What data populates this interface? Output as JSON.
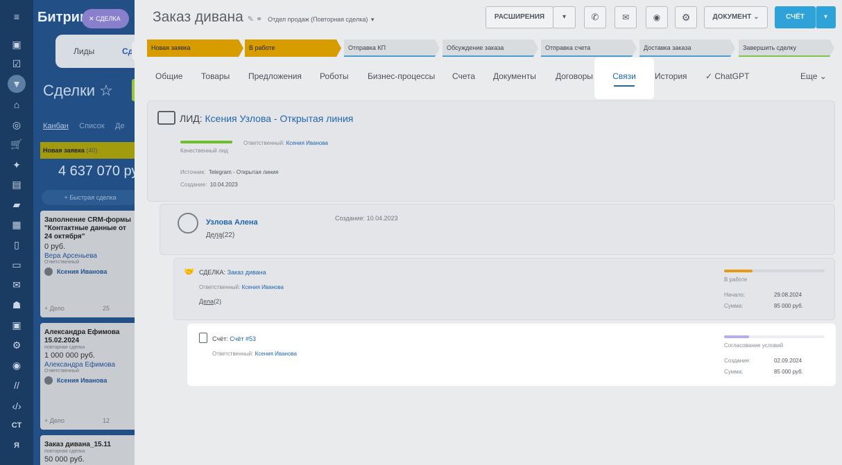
{
  "rail": {
    "items": [
      "menu-icon",
      "home-icon",
      "tasks-icon",
      "filter-icon",
      "bank-icon",
      "target-icon",
      "cart-icon",
      "puzzle-icon",
      "window-icon",
      "chat-icon",
      "calendar-icon",
      "document-icon",
      "drive-icon",
      "mail-icon",
      "team-icon",
      "id-icon",
      "robot-icon",
      "database-icon",
      "marketing-icon",
      "code-icon"
    ],
    "ct": "СТ",
    "ya": "Я"
  },
  "background": {
    "brand": "Битрик",
    "deal_chip": "СДЕЛКА",
    "tab_leads": "Лиды",
    "tab_deals": "Сд",
    "title": "Сделки",
    "views": {
      "kanban": "Канбан",
      "list": "Список",
      "other": "Де"
    },
    "column": {
      "name": "Новая заявка",
      "count": "(40)",
      "sum": "4 637 070 ру"
    },
    "quick_add": "+ Быстрая сделка",
    "cards": [
      {
        "title": "Заполнение CRM-формы \"Контактные данные от 24 октября\"",
        "price": "0 руб.",
        "contact": "Вера Арсеньева",
        "role": "Ответственный",
        "resp": "Ксения Иванова",
        "foot": "+ Дело",
        "foot_num": "25"
      },
      {
        "title": "Александра Ефимова 15.02.2024",
        "sub": "повторная сделка",
        "price": "1 000 000 руб.",
        "contact": "Александра Ефимова",
        "role": "Ответственный",
        "resp": "Ксения Иванова",
        "foot": "+ Дело",
        "foot_num": "12"
      },
      {
        "title": "Заказ дивана_15.11",
        "sub": "повторная сделка",
        "price": "50 000 руб."
      }
    ]
  },
  "header": {
    "title": "Заказ дивана",
    "category": "Отдел продаж (Повторная сделка)",
    "extensions_label": "РАСШИРЕНИЯ",
    "document_label": "ДОКУМЕНТ",
    "invoice_label": "СЧЁТ"
  },
  "stages": [
    {
      "label": "Новая заявка",
      "state": "done"
    },
    {
      "label": "В работе",
      "state": "done"
    },
    {
      "label": "Отправка КП",
      "state": "todo"
    },
    {
      "label": "Обсуждение заказа",
      "state": "todo"
    },
    {
      "label": "Отправка счета",
      "state": "todo"
    },
    {
      "label": "Доставка заказа",
      "state": "todo"
    },
    {
      "label": "Завершить сделку",
      "state": "last"
    }
  ],
  "tabs": {
    "general": "Общие",
    "products": "Товары",
    "offers": "Предложения",
    "robots": "Роботы",
    "bp": "Бизнес-процессы",
    "invoices": "Счета",
    "documents": "Документы",
    "contracts": "Договоры",
    "links": "Связи",
    "history": "История",
    "chatgpt": "✓ ChatGPT",
    "more": "Еще"
  },
  "lead": {
    "prefix": "ЛИД:",
    "name": "Ксения Узлова - Открытая линия",
    "status": "Качественный лид",
    "responsible_label": "Ответственный:",
    "responsible": "Ксения Иванова",
    "source_label": "Источник:",
    "source": "Telegram - Открытая линия",
    "created_label": "Создание:",
    "created": "10.04.2023",
    "progress": 1.0
  },
  "contact": {
    "name": "Узлова Алена",
    "deals_label": "Дела",
    "deals_count": "(22)",
    "created": "Создание: 10.04.2023"
  },
  "deal": {
    "prefix": "СДЕЛКА:",
    "name": "Заказ дивана",
    "responsible_label": "Ответственный:",
    "responsible": "Ксения Иванова",
    "deals_label": "Дела",
    "deals_count": "(2)",
    "status": "В работе",
    "start_label": "Начало:",
    "start": "29.08.2024",
    "sum_label": "Сумма:",
    "sum": "85 000 руб.",
    "progress": 0.28
  },
  "invoice": {
    "prefix": "Счёт:",
    "name": "Счёт #53",
    "responsible_label": "Ответственный:",
    "responsible": "Ксения Иванова",
    "status": "Согласование условий",
    "created_label": "Создание:",
    "created": "02.09.2024",
    "sum_label": "Сумма:",
    "sum": "85 000 руб.",
    "progress": 0.25
  },
  "colors": {
    "accent": "#2fa3d8",
    "stage_done": "#d69c00",
    "lead_bar": "#6cbf26",
    "deal_bar": "#e89a16",
    "invoice_bar": "#b6aee6"
  }
}
